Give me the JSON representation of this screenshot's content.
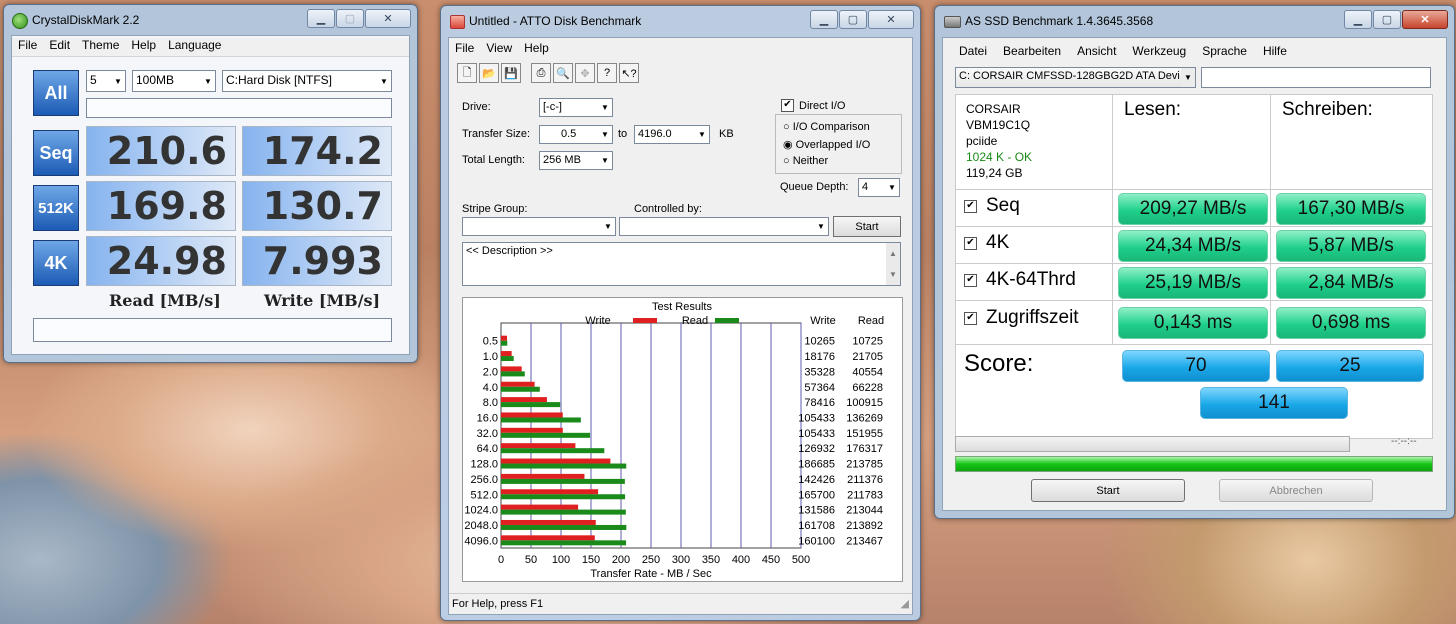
{
  "crystal": {
    "title": "CrystalDiskMark 2.2",
    "menu": [
      "File",
      "Edit",
      "Theme",
      "Help",
      "Language"
    ],
    "runs": "5",
    "size": "100MB",
    "drive": "C:Hard Disk [NTFS]",
    "all_label": "All",
    "rows": [
      {
        "label": "Seq",
        "read": "210.6",
        "write": "174.2"
      },
      {
        "label": "512K",
        "read": "169.8",
        "write": "130.7"
      },
      {
        "label": "4K",
        "read": "24.98",
        "write": "7.993"
      }
    ],
    "read_header": "Read [MB/s]",
    "write_header": "Write [MB/s]"
  },
  "atto": {
    "title": "Untitled - ATTO Disk Benchmark",
    "menu": [
      "File",
      "View",
      "Help"
    ],
    "drive_label": "Drive:",
    "drive_value": "[-c-]",
    "transfer_size_label": "Transfer Size:",
    "transfer_from": "0.5",
    "to_label": "to",
    "transfer_to": "4196.0",
    "kb_label": "KB",
    "total_length_label": "Total Length:",
    "total_length": "256 MB",
    "direct_io": "Direct I/O",
    "io_comparison": "I/O Comparison",
    "overlapped_io": "Overlapped I/O",
    "neither": "Neither",
    "queue_depth_label": "Queue Depth:",
    "queue_depth": "4",
    "stripe_group_label": "Stripe Group:",
    "controlled_by_label": "Controlled by:",
    "start_label": "Start",
    "description": "<< Description >>",
    "results_title": "Test Results",
    "legend_write": "Write",
    "legend_read": "Read",
    "col_write": "Write",
    "col_read": "Read",
    "x_axis_label": "Transfer Rate - MB / Sec",
    "status": "For Help, press F1",
    "colors": {
      "write": "#e02020",
      "read": "#1a8a1a"
    }
  },
  "chart_data": {
    "type": "bar",
    "title": "Test Results",
    "xlabel": "Transfer Rate - MB / Sec",
    "categories": [
      "0.5",
      "1.0",
      "2.0",
      "4.0",
      "8.0",
      "16.0",
      "32.0",
      "64.0",
      "128.0",
      "256.0",
      "512.0",
      "1024.0",
      "2048.0",
      "4096.0"
    ],
    "x_ticks": [
      "0",
      "50",
      "100",
      "150",
      "200",
      "250",
      "300",
      "350",
      "400",
      "450",
      "500"
    ],
    "xlim": [
      0,
      500
    ],
    "series": [
      {
        "name": "Write",
        "values": [
          10265,
          18176,
          35328,
          57364,
          78416,
          105433,
          105433,
          126932,
          186685,
          142426,
          165700,
          131586,
          161708,
          160100
        ]
      },
      {
        "name": "Read",
        "values": [
          10725,
          21705,
          40554,
          66228,
          100915,
          136269,
          151955,
          176317,
          213785,
          211376,
          211783,
          213044,
          213892,
          213467
        ]
      }
    ]
  },
  "asssd": {
    "title": "AS SSD Benchmark 1.4.3645.3568",
    "menu": [
      "Datei",
      "Bearbeiten",
      "Ansicht",
      "Werkzeug",
      "Sprache",
      "Hilfe"
    ],
    "device": "C: CORSAIR CMFSSD-128GBG2D ATA Devi",
    "info": [
      "CORSAIR",
      "VBM19C1Q",
      "pciide",
      "1024 K - OK",
      "119,24 GB"
    ],
    "read_header": "Lesen:",
    "write_header": "Schreiben:",
    "rows": [
      {
        "label": "Seq",
        "read": "209,27 MB/s",
        "write": "167,30 MB/s"
      },
      {
        "label": "4K",
        "read": "24,34 MB/s",
        "write": "5,87 MB/s"
      },
      {
        "label": "4K-64Thrd",
        "read": "25,19 MB/s",
        "write": "2,84 MB/s"
      },
      {
        "label": "Zugriffszeit",
        "read": "0,143 ms",
        "write": "0,698 ms"
      }
    ],
    "score_label": "Score:",
    "score_read": "70",
    "score_write": "25",
    "score_total": "141",
    "time": "--:--:--",
    "start_label": "Start",
    "cancel_label": "Abbrechen"
  }
}
